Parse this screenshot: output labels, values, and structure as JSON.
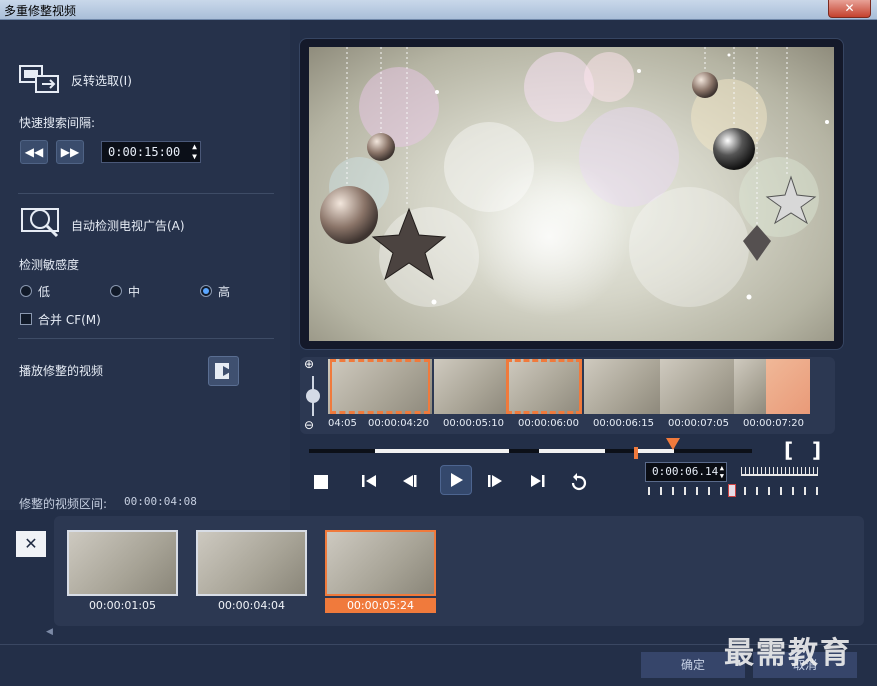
{
  "window": {
    "title": "多重修整视频",
    "close_label": "✕"
  },
  "left": {
    "invert_label": "反转选取(I)",
    "fast_search_label": "快速搜索间隔:",
    "rewind_btn": "◀◀",
    "forward_btn": "▶▶",
    "interval_value": "0:00:15:00",
    "detect_ad_label": "自动检测电视广告(A)",
    "sensitivity_label": "检测敏感度",
    "sensitivity_options": [
      "低",
      "中",
      "高"
    ],
    "sensitivity_selected": "高",
    "merge_label": "合并 CF(M)",
    "play_trimmed_label": "播放修整的视频",
    "trimmed_interval_label": "修整的视频区间:",
    "trimmed_interval_value": "00:00:04:08"
  },
  "timeline": {
    "tick_labels": [
      "04:05",
      "00:00:04:20",
      "00:00:05:10",
      "00:00:06:00",
      "00:00:06:15",
      "00:00:07:05",
      "00:00:07:20"
    ],
    "current_time": "0:00:06.14",
    "mark_in": "[",
    "mark_out": "]"
  },
  "clips": [
    {
      "time": "00:00:01:05",
      "selected": false
    },
    {
      "time": "00:00:04:04",
      "selected": false
    },
    {
      "time": "00:00:05:24",
      "selected": true
    }
  ],
  "buttons": {
    "ok": "确定",
    "cancel": "取消",
    "delete": "✕"
  },
  "watermark": "最需教育",
  "colors": {
    "accent": "#f07a3c",
    "panel": "#26324b",
    "background": "#1a2236"
  }
}
